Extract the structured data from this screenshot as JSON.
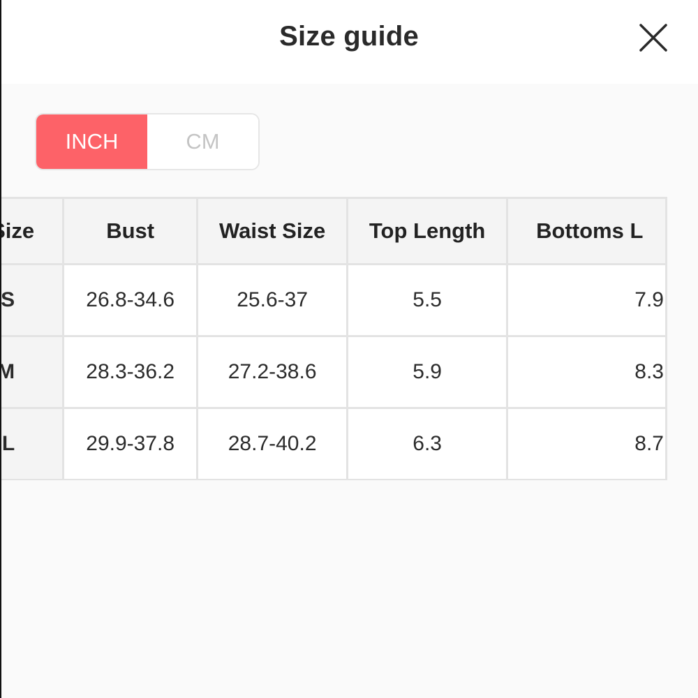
{
  "header": {
    "title": "Size guide",
    "close_icon": "close-icon"
  },
  "unit_toggle": {
    "options": [
      "INCH",
      "CM"
    ],
    "selected": "INCH",
    "active_color": "#fd6268"
  },
  "size_table": {
    "columns": [
      "Size",
      "Bust",
      "Waist Size",
      "Top Length",
      "Bottoms L"
    ],
    "rows": [
      [
        "S",
        "26.8-34.6",
        "25.6-37",
        "5.5",
        "7.9"
      ],
      [
        "M",
        "28.3-36.2",
        "27.2-38.6",
        "5.9",
        "8.3"
      ],
      [
        "L",
        "29.9-37.8",
        "28.7-40.2",
        "6.3",
        "8.7"
      ]
    ]
  }
}
